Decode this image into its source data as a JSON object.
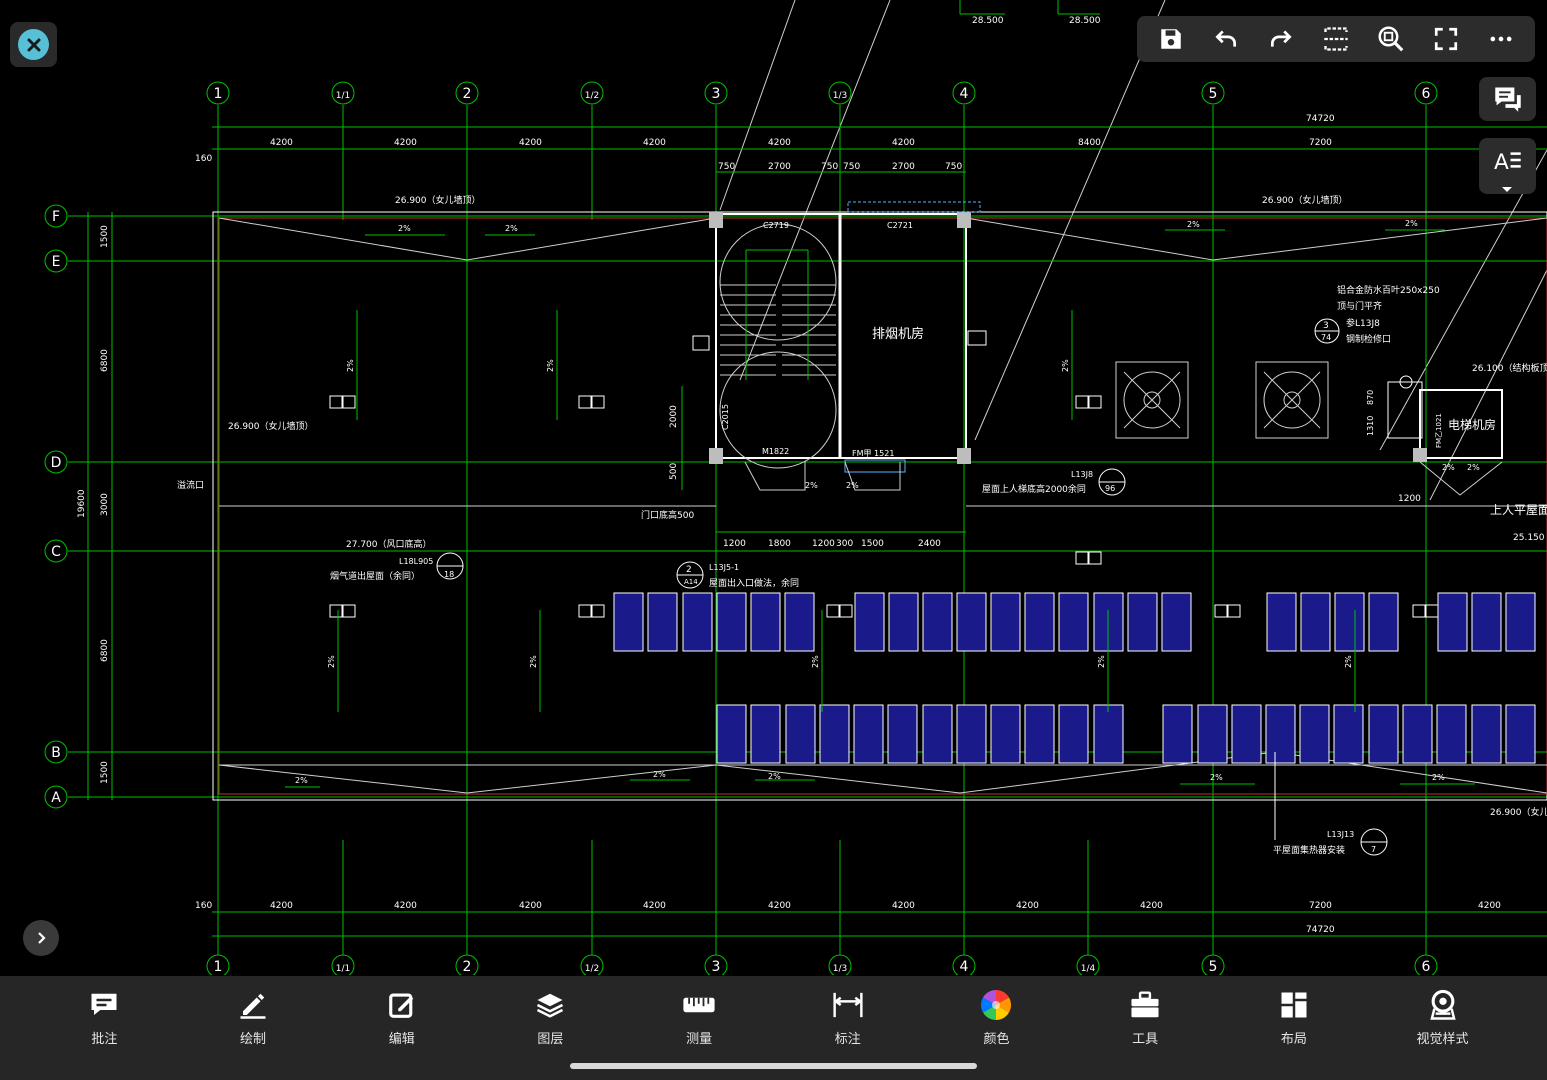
{
  "drawing": {
    "elevations_top": [
      "28.500",
      "28.500"
    ],
    "grid_top": [
      "1",
      "1/1",
      "2",
      "1/2",
      "3",
      "1/3",
      "4",
      "5",
      "6"
    ],
    "grid_bottom": [
      "1",
      "1/1",
      "2",
      "1/2",
      "3",
      "1/3",
      "4",
      "1/4",
      "5",
      "6"
    ],
    "grid_left": [
      "F",
      "E",
      "D",
      "C",
      "B",
      "A"
    ],
    "dims_top_total": "74720",
    "dims_top": [
      "4200",
      "4200",
      "4200",
      "4200",
      "4200",
      "4200",
      "8400",
      "7200"
    ],
    "dims_top_edge": "160",
    "stair_dims": [
      "750",
      "2700",
      "750",
      "750",
      "2700",
      "750"
    ],
    "dims_left": [
      "1500",
      "6800",
      "3000",
      "6800",
      "1500"
    ],
    "dims_left_total": "19600",
    "dims_bottom": [
      "4200",
      "4200",
      "4200",
      "4200",
      "4200",
      "4200",
      "4200",
      "4200",
      "7200",
      "4200"
    ],
    "dims_bottom_edge": "160",
    "dims_bottom_total": "74720",
    "door_dims": [
      "1200",
      "1800",
      "1200",
      "300",
      "1500",
      "2400"
    ],
    "stair_left_dims": [
      "2000",
      "500"
    ],
    "parapet_label": "26.900（女儿墙顶）",
    "parapet_label_cut": "26.900（女儿",
    "slope": "2%",
    "window_c2719": "C2719",
    "window_c2721": "C2721",
    "door_m1822": "M1822",
    "door_fm": "FM甲 1521",
    "room_smoke": "排烟机房",
    "room_elevator": "电梯机房",
    "fm_yi": "FM乙1021",
    "louver_note1": "铝合金防水百叶250x250",
    "louver_note2": "顶与门平齐",
    "hatch_code": "参L13J8",
    "hatch_note": "钢制检修口",
    "detail3_num": "3",
    "detail3_sheet": "74",
    "elev_26100": "26.100（结构板顶）",
    "elev_25150": "25.150",
    "elev_27700": "27.700（风口底高）",
    "vent_code": "L18L905",
    "vent_note": "烟气道出屋面（余同）",
    "vent_detail": "18",
    "overflow": "溢流口",
    "door_sill": "门口底高500",
    "exit_code": "L13J5-1",
    "exit_detail": "2",
    "exit_sheet": "A14",
    "exit_note": "屋面出入口做法，余同",
    "ladder_code": "L13J8",
    "ladder_note": "屋面上人梯底高2000余同",
    "ladder_detail": "96",
    "solar_code": "L13J13",
    "solar_note": "平屋面集热器安装",
    "solar_detail": "7",
    "roof_label": "上人平屋面",
    "elev_dims": [
      "870",
      "1310",
      "1200"
    ],
    "stair_mark": "C2015"
  },
  "toolbar": {
    "save": "save-icon",
    "undo": "undo-icon",
    "redo": "redo-icon",
    "crop": "crop-icon",
    "zoom": "zoom-fit-icon",
    "fullscreen": "fullscreen-icon",
    "more": "more-icon"
  },
  "bottom_bar": [
    {
      "label": "批注",
      "icon": "comment-icon"
    },
    {
      "label": "绘制",
      "icon": "pencil-icon"
    },
    {
      "label": "编辑",
      "icon": "edit-icon"
    },
    {
      "label": "图层",
      "icon": "layers-icon"
    },
    {
      "label": "测量",
      "icon": "ruler-icon"
    },
    {
      "label": "标注",
      "icon": "dimension-icon"
    },
    {
      "label": "颜色",
      "icon": "color-wheel-icon"
    },
    {
      "label": "工具",
      "icon": "toolbox-icon"
    },
    {
      "label": "布局",
      "icon": "layout-icon"
    },
    {
      "label": "视觉样式",
      "icon": "visual-style-icon"
    }
  ],
  "colors": {
    "background": "#000000",
    "grid": "#00c000",
    "wall": "#ffffff",
    "panel": "#1a1a8a",
    "accent": "#56c1d6",
    "red": "#c03030"
  }
}
